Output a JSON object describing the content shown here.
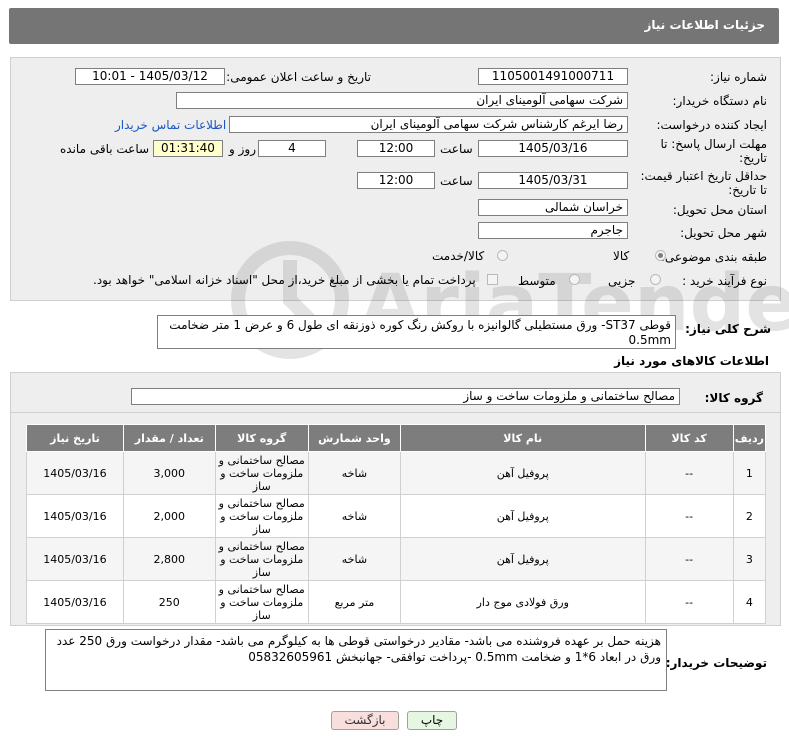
{
  "header": {
    "title": "جزئیات اطلاعات نیاز"
  },
  "form": {
    "need_number_label": "شماره نیاز:",
    "need_number": "1105001491000711",
    "announce_label": "تاریخ و ساعت اعلان عمومی:",
    "announce_value": "1405/03/12 - 10:01",
    "buyer_org_label": "نام دستگاه خریدار:",
    "buyer_org": "شرکت سهامی آلومینای ایران",
    "creator_label": "ایجاد کننده درخواست:",
    "creator": "رضا ایرغم کارشناس شرکت سهامی آلومینای ایران",
    "contact_link": "اطلاعات تماس خریدار",
    "deadline_label_1": "مهلت ارسال پاسخ: تا",
    "deadline_label_2": "تاریخ:",
    "deadline_date": "1405/03/16",
    "time_word": "ساعت",
    "deadline_time": "12:00",
    "days_value": "4",
    "days_word": "روز و",
    "remaining_value": "01:31:40",
    "remaining_word": "ساعت باقی مانده",
    "validity_label_1": "حداقل تاریخ اعتبار قیمت:",
    "validity_label_2": "تا تاریخ:",
    "validity_date": "1405/03/31",
    "validity_time": "12:00",
    "province_label": "استان محل تحویل:",
    "province": "خراسان شمالی",
    "city_label": "شهر محل تحویل:",
    "city": "جاجرم",
    "category_label": "طبقه بندی موضوعی:",
    "category_options": [
      "کالا",
      "کالا/خدمت"
    ],
    "category_selected": "کالا",
    "process_label": "نوع فرآیند خرید :",
    "process_options": [
      "جزیی",
      "متوسط"
    ],
    "payment_note": "پرداخت تمام یا بخشی از مبلغ خرید،از محل \"اسناد خزانه اسلامی\" خواهد بود."
  },
  "summary": {
    "label": "شرح کلی نیاز:",
    "text": "قوطی ST37- ورق مستطیلی گالوانیزه با روکش رنگ کوره ذوزنقه ای طول 6 و عرض 1 متر ضخامت 0.5mm"
  },
  "goods_section": {
    "title": "اطلاعات کالاهای مورد نیاز",
    "group_label": "گروه کالا:",
    "group_value": "مصالح ساختمانی و ملزومات ساخت و ساز"
  },
  "table": {
    "headers": [
      "ردیف",
      "کد کالا",
      "نام کالا",
      "واحد شمارش",
      "گروه کالا",
      "تعداد / مقدار",
      "تاریخ نیاز"
    ],
    "rows": [
      [
        "1",
        "--",
        "پروفیل آهن",
        "شاخه",
        "مصالح ساختمانی و ملزومات ساخت و ساز",
        "3,000",
        "1405/03/16"
      ],
      [
        "2",
        "--",
        "پروفیل آهن",
        "شاخه",
        "مصالح ساختمانی و ملزومات ساخت و ساز",
        "2,000",
        "1405/03/16"
      ],
      [
        "3",
        "--",
        "پروفیل آهن",
        "شاخه",
        "مصالح ساختمانی و ملزومات ساخت و ساز",
        "2,800",
        "1405/03/16"
      ],
      [
        "4",
        "--",
        "ورق فولادی موج دار",
        "متر مربع",
        "مصالح ساختمانی و ملزومات ساخت و ساز",
        "250",
        "1405/03/16"
      ]
    ]
  },
  "buyer_notes": {
    "label": "توضیحات خریدار:",
    "text": "هزینه حمل بر عهده فروشنده می باشد- مقادیر درخواستی قوطی ها به کیلوگرم می باشد- مقدار درخواست ورق 250 عدد ورق در ابعاد 6*1 و ضخامت 0.5mm -پرداخت توافقی- جهانبخش 05832605961"
  },
  "buttons": {
    "print": "چاپ",
    "back": "بازگشت"
  },
  "colors": {
    "header_bg": "#757575",
    "panel_bg": "#eeeeee",
    "link": "#1a56c7",
    "highlight": "#ffffcc",
    "back_button": "#f9dede",
    "print_button": "#e5f7e1"
  }
}
